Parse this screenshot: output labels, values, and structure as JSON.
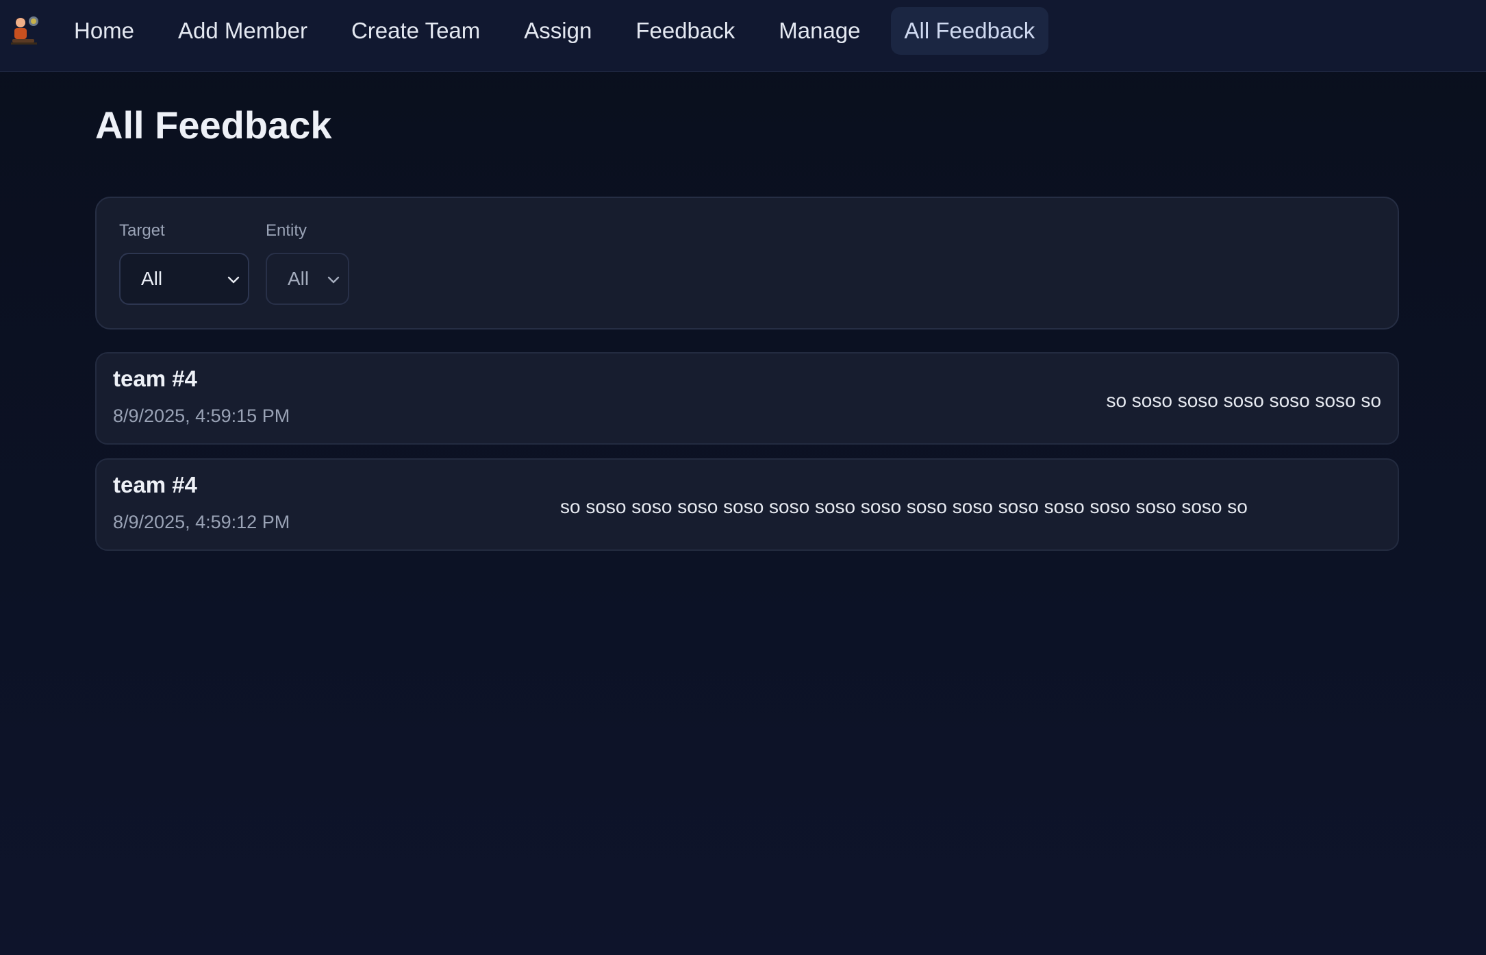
{
  "nav": {
    "items": [
      {
        "label": "Home",
        "active": false
      },
      {
        "label": "Add Member",
        "active": false
      },
      {
        "label": "Create Team",
        "active": false
      },
      {
        "label": "Assign",
        "active": false
      },
      {
        "label": "Feedback",
        "active": false
      },
      {
        "label": "Manage",
        "active": false
      },
      {
        "label": "All Feedback",
        "active": true
      }
    ]
  },
  "page": {
    "title": "All Feedback"
  },
  "filters": {
    "target": {
      "label": "Target",
      "value": "All"
    },
    "entity": {
      "label": "Entity",
      "value": "All"
    }
  },
  "feedback": [
    {
      "title": "team #4",
      "date": "8/9/2025, 4:59:15 PM",
      "text": "so soso soso soso soso soso so"
    },
    {
      "title": "team #4",
      "date": "8/9/2025, 4:59:12 PM",
      "text": "so soso soso soso soso soso soso soso soso soso soso soso soso soso soso so"
    }
  ],
  "colors": {
    "background": "#0c1225",
    "surface": "#171d2e",
    "active_nav": "#1b2642",
    "muted_text": "#9aa3b6"
  }
}
